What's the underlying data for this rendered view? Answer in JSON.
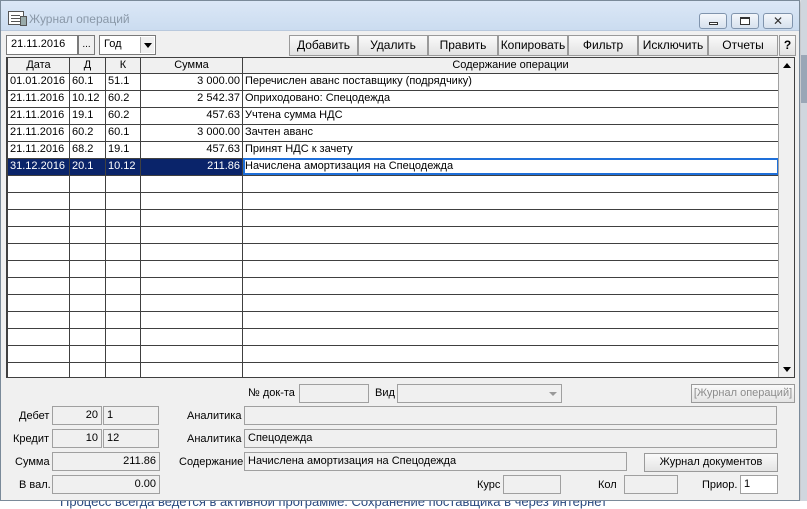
{
  "window": {
    "title": "Журнал операций"
  },
  "toolbar": {
    "date": "21.11.2016",
    "dots_label": "...",
    "period": "Год",
    "buttons": [
      "Добавить",
      "Удалить",
      "Править",
      "Копировать",
      "Фильтр",
      "Исключить",
      "Отчеты"
    ],
    "help_label": "?"
  },
  "grid": {
    "headers": [
      "Дата",
      "Д",
      "К",
      "Сумма",
      "Содержание операции"
    ],
    "rows": [
      {
        "date": "01.01.2016",
        "debit": "60.1",
        "credit": "51.1",
        "sum": "3 000.00",
        "text": "Перечислен аванс поставщику (подрядчику)"
      },
      {
        "date": "21.11.2016",
        "debit": "10.12",
        "credit": "60.2",
        "sum": "2 542.37",
        "text": "Оприходовано: Спецодежда"
      },
      {
        "date": "21.11.2016",
        "debit": "19.1",
        "credit": "60.2",
        "sum": "457.63",
        "text": "Учтена сумма НДС"
      },
      {
        "date": "21.11.2016",
        "debit": "60.2",
        "credit": "60.1",
        "sum": "3 000.00",
        "text": "Зачтен аванс"
      },
      {
        "date": "21.11.2016",
        "debit": "68.2",
        "credit": "19.1",
        "sum": "457.63",
        "text": "Принят НДС к зачету"
      },
      {
        "date": "31.12.2016",
        "debit": "20.1",
        "credit": "10.12",
        "sum": "211.86",
        "text": "Начислена амортизация на Спецодежда"
      }
    ],
    "selected_row": 5
  },
  "details": {
    "doc_no_label": "№ док-та",
    "doc_no_value": "",
    "kind_label": "Вид",
    "kind_value": "",
    "journal_ops_button": "[Журнал операций]",
    "debit_label": "Дебет",
    "debit_account": "20",
    "debit_sub": "1",
    "analytics_label_1": "Аналитика",
    "analytics_value_1": "",
    "credit_label": "Кредит",
    "credit_account": "10",
    "credit_sub": "12",
    "analytics_label_2": "Аналитика",
    "analytics_value_2": "Спецодежда",
    "sum_label": "Сумма",
    "sum_value": "211.86",
    "content_label": "Содержание",
    "content_value": "Начислена амортизация на Спецодежда",
    "journal_docs_button": "Журнал документов",
    "currency_label": "В вал.",
    "currency_value": "0.00",
    "rate_label": "Курс",
    "rate_value": "",
    "qty_label": "Кол",
    "qty_value": "",
    "priority_label": "Приор.",
    "priority_value": "1"
  },
  "background_text": "Процесс всегда ведётся в активной программе. Сохранение поставщика в через интернет"
}
